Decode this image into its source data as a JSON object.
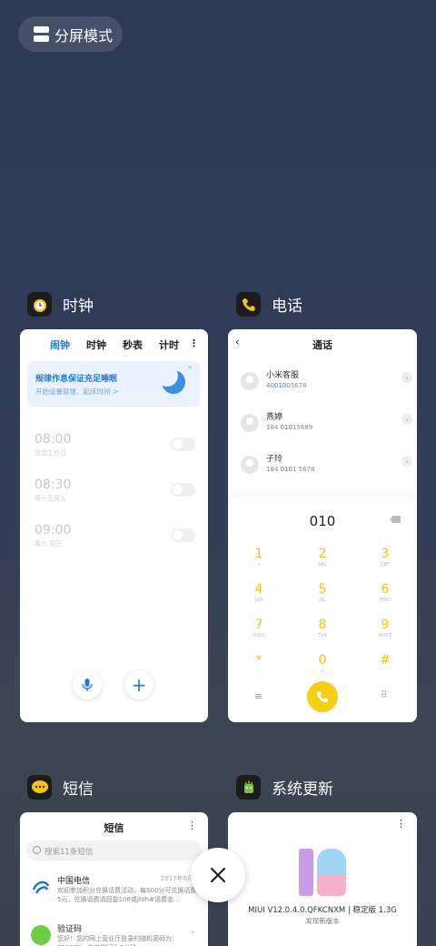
{
  "split_screen": {
    "label": "分屏模式"
  },
  "apps": {
    "clock": {
      "name": "时钟",
      "tabs": [
        "闹钟",
        "时钟",
        "秒表",
        "计时"
      ],
      "active_tab": "闹钟",
      "banner": {
        "title": "规律作息保证充足睡眠",
        "subtitle": "开始设置就寝、起床时间 >"
      },
      "alarms": [
        {
          "time": "08:00",
          "sub": "法定工作日"
        },
        {
          "time": "08:30",
          "sub": "周一至周五"
        },
        {
          "time": "09:00",
          "sub": "周六 周日"
        }
      ]
    },
    "phone": {
      "name": "电话",
      "title": "通话",
      "contacts": [
        {
          "name": "小米客服",
          "num_pre": "40",
          "num_hl": "010",
          "num_post": "05678"
        },
        {
          "name": "燕婷",
          "num_pre": "184 ",
          "num_hl": "010",
          "num_post": "15689"
        },
        {
          "name": "子玲",
          "num_pre": "184 ",
          "num_hl": "010",
          "num_post": "1 5678"
        }
      ],
      "dialed": "010",
      "keys": [
        {
          "d": "1",
          "s": "∞"
        },
        {
          "d": "2",
          "s": "ABC"
        },
        {
          "d": "3",
          "s": "DEF"
        },
        {
          "d": "4",
          "s": "GHI"
        },
        {
          "d": "5",
          "s": "JKL"
        },
        {
          "d": "6",
          "s": "MNO"
        },
        {
          "d": "7",
          "s": "PQRS"
        },
        {
          "d": "8",
          "s": "TUV"
        },
        {
          "d": "9",
          "s": "WXYZ"
        },
        {
          "d": "*",
          "s": ","
        },
        {
          "d": "0",
          "s": "+"
        },
        {
          "d": "#",
          "s": ""
        }
      ]
    },
    "sms": {
      "name": "短信",
      "title": "短信",
      "search_placeholder": "搜索11条短信",
      "messages": [
        {
          "from": "中国电信",
          "date": "2017年6月30",
          "text": "欢迎参加积分兑换话费活动，每500分可兑换话费5元，兑换话费请回复106或jfdh#话费金..."
        },
        {
          "from": "验证码",
          "date": "",
          "text": "您好！您的网上营业厅登录的随机密码为：710679，有效时间为3分钟..."
        }
      ]
    },
    "update": {
      "name": "系统更新",
      "version": "MIUI V12.0.4.0.QFKCNXM | 稳定版 1.3G",
      "status": "发现新版本"
    }
  },
  "colors": {
    "accent": "#1f7bd8",
    "dial": "#f4cf12"
  }
}
